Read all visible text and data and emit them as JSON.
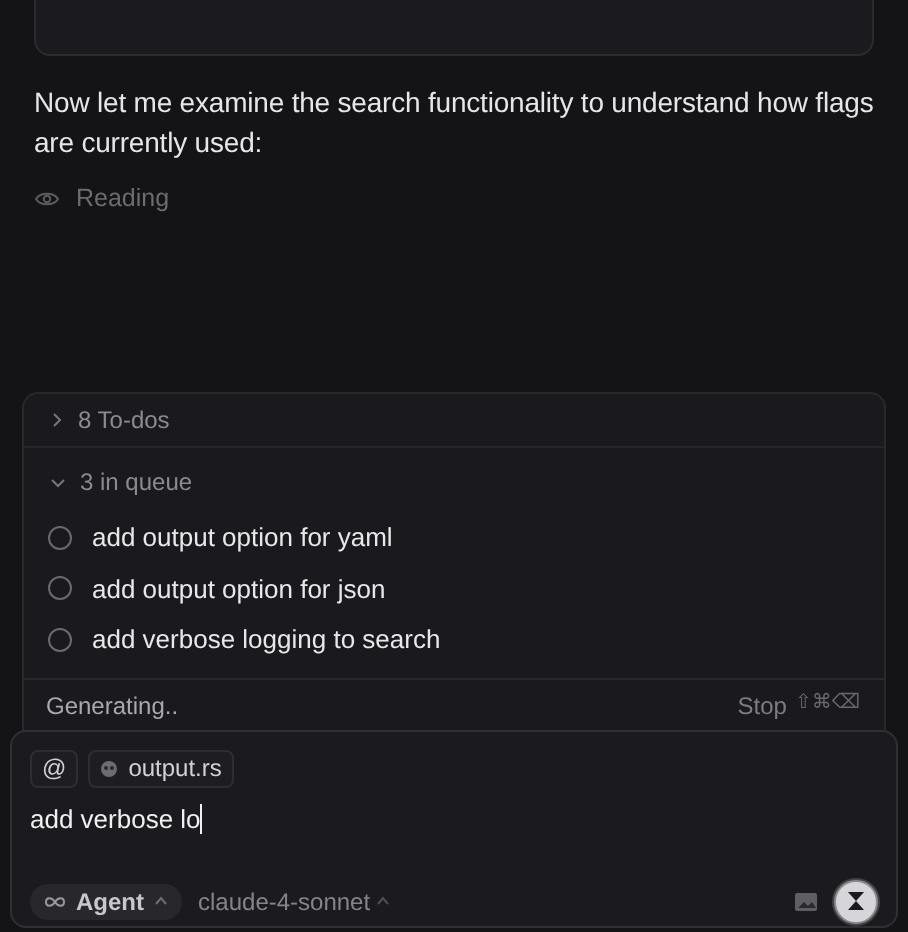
{
  "message": {
    "text": "Now let me examine the search functionality to understand how flags are currently used:"
  },
  "status": {
    "label": "Reading"
  },
  "todos": {
    "label": "8 To-dos",
    "expanded": false
  },
  "queue": {
    "label": "3 in queue",
    "expanded": true,
    "items": [
      {
        "text": "add output option for yaml",
        "checked": false
      },
      {
        "text": "add output option for json",
        "checked": false
      },
      {
        "text": "add verbose logging to search",
        "checked": false
      }
    ]
  },
  "generating": {
    "label": "Generating..",
    "stop": "Stop",
    "shortcut": "⇧⌘⌫"
  },
  "composer": {
    "mention": "@",
    "file_chip": "output.rs",
    "value": "add verbose lo",
    "mode": "Agent",
    "model": "claude-4-sonnet"
  }
}
